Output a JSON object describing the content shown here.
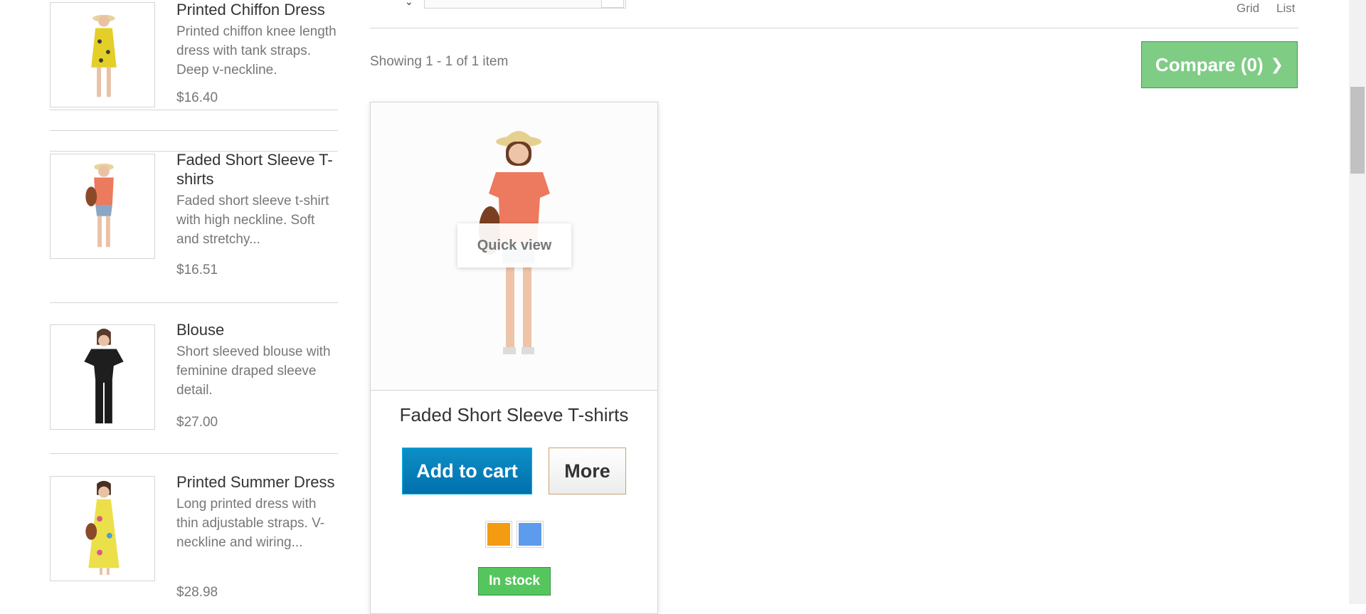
{
  "sidebar": {
    "products": [
      {
        "name": "Printed Chiffon Dress",
        "description": "Printed chiffon knee length dress with tank straps. Deep v-neckline.",
        "price": "$16.40",
        "image": "woman-yellow-dress-image"
      },
      {
        "name": "Faded Short Sleeve T-shirts",
        "description": "Faded short sleeve t-shirt with high neckline. Soft and stretchy...",
        "price": "$16.51",
        "image": "woman-orange-tshirt-image"
      },
      {
        "name": "Blouse",
        "description": "Short sleeved blouse with feminine draped sleeve detail.",
        "price": "$27.00",
        "image": "woman-black-blouse-image"
      },
      {
        "name": "Printed Summer Dress",
        "description": "Long printed dress with thin adjustable straps. V-neckline and wiring...",
        "price": "$28.98",
        "image": "woman-yellow-long-dress-image"
      }
    ]
  },
  "toolbar": {
    "view_grid": "Grid",
    "view_list": "List",
    "showing": "Showing 1 - 1 of 1 item",
    "compare_label": "Compare (0)"
  },
  "product": {
    "name": "Faded Short Sleeve T-shirts",
    "quick_view": "Quick view",
    "add_to_cart": "Add to cart",
    "more": "More",
    "colors": [
      "#f39c11",
      "#5d9cec"
    ],
    "availability": "In stock"
  },
  "colors": {
    "accent_blue": "#0079ba",
    "compare_green": "#7fcc85",
    "stock_green": "#55c65e"
  }
}
